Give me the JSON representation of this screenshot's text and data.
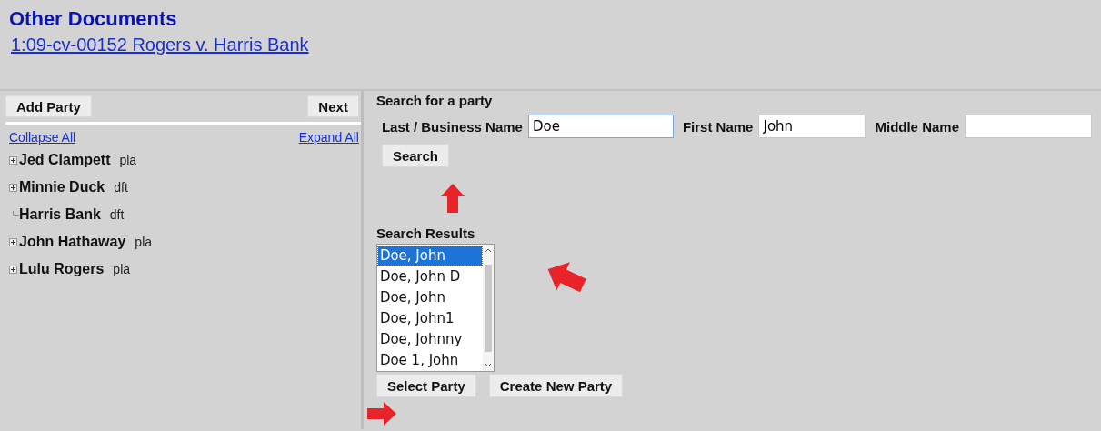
{
  "header": {
    "title": "Other Documents",
    "case_link": "1:09-cv-00152 Rogers v. Harris Bank"
  },
  "left_panel": {
    "buttons": [
      "Add Party",
      "Next"
    ],
    "collapse_link": "Collapse All",
    "expand_link": "Expand All",
    "parties": [
      {
        "name": "Jed Clampett",
        "role": "pla",
        "expandable": true
      },
      {
        "name": "Minnie Duck",
        "role": "dft",
        "expandable": true
      },
      {
        "name": "Harris Bank",
        "role": "dft",
        "expandable": false
      },
      {
        "name": "John Hathaway",
        "role": "pla",
        "expandable": true
      },
      {
        "name": "Lulu Rogers",
        "role": "pla",
        "expandable": true
      }
    ]
  },
  "search": {
    "title": "Search for a party",
    "fields": [
      {
        "label": "Last / Business Name",
        "value": "Doe",
        "focused": true
      },
      {
        "label": "First Name",
        "value": "John",
        "focused": false
      },
      {
        "label": "Middle Name",
        "focused": false
      }
    ],
    "button": "Search"
  },
  "results": {
    "title": "Search Results",
    "items": [
      {
        "label": "Doe, John",
        "selected": true
      },
      {
        "label": "Doe, John D",
        "selected": false
      },
      {
        "label": "Doe, John",
        "selected": false
      },
      {
        "label": "Doe, John1",
        "selected": false
      },
      {
        "label": "Doe, Johnny",
        "selected": false
      },
      {
        "label": "Doe 1, John",
        "selected": false
      }
    ],
    "buttons": [
      "Select Party",
      "Create New Party"
    ]
  }
}
